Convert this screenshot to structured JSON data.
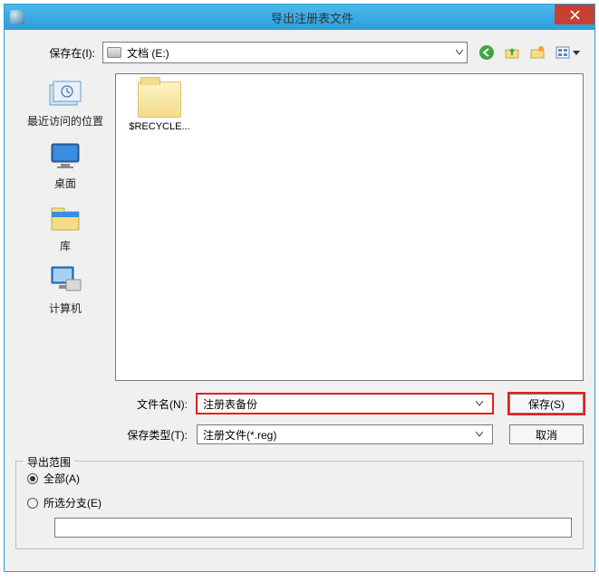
{
  "title": "导出注册表文件",
  "save_in_label": "保存在(I):",
  "location": {
    "text": "文档 (E:)"
  },
  "sidebar": {
    "items": [
      {
        "label": "最近访问的位置"
      },
      {
        "label": "桌面"
      },
      {
        "label": "库"
      },
      {
        "label": "计算机"
      }
    ]
  },
  "filelist": {
    "items": [
      {
        "name": "$RECYCLE..."
      }
    ]
  },
  "filename_label": "文件名(N):",
  "filename_value": "注册表备份",
  "filetype_label": "保存类型(T):",
  "filetype_value": "注册文件(*.reg)",
  "save_button": "保存(S)",
  "cancel_button": "取消",
  "range": {
    "legend": "导出范围",
    "all_label": "全部(A)",
    "branch_label": "所选分支(E)",
    "branch_value": ""
  }
}
